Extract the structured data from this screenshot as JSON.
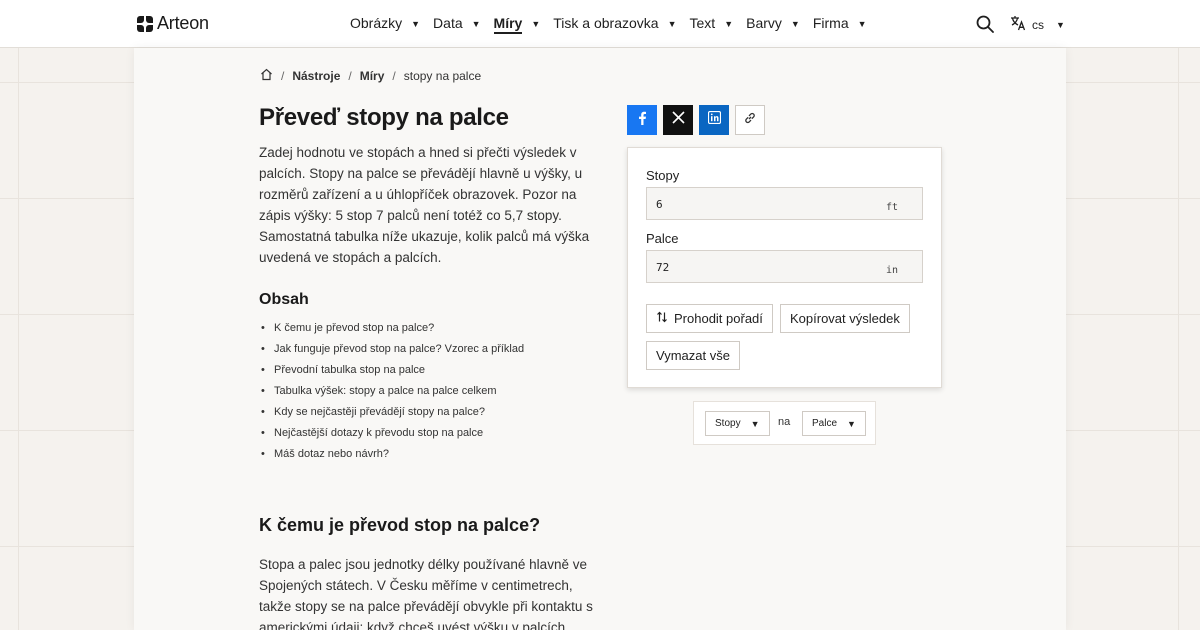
{
  "header": {
    "logo_text": "Arteon",
    "nav": [
      {
        "label": "Obrázky",
        "active": false
      },
      {
        "label": "Data",
        "active": false
      },
      {
        "label": "Míry",
        "active": true
      },
      {
        "label": "Tisk a obrazovka",
        "active": false
      },
      {
        "label": "Text",
        "active": false
      },
      {
        "label": "Barvy",
        "active": false
      },
      {
        "label": "Firma",
        "active": false
      }
    ],
    "search_icon": "search-icon",
    "lang_icon": "translate-icon",
    "lang": "cs"
  },
  "breadcrumb": {
    "home_icon": "home-icon",
    "items": [
      "Nástroje",
      "Míry",
      "stopy na palce"
    ]
  },
  "article": {
    "title": "Převeď stopy na palce",
    "intro": "Zadej hodnotu ve stopách a hned si přečti výsledek v palcích. Stopy na palce se převádějí hlavně u výšky, u rozměrů zařízení a u úhlopříček obrazovek. Pozor na zápis výšky: 5 stop 7 palců není totéž co 5,7 stopy. Samostatná tabulka níže ukazuje, kolik palců má výška uvedená ve stopách a palcích.",
    "toc_title": "Obsah",
    "toc": [
      "K čemu je převod stop na palce?",
      "Jak funguje převod stop na palce? Vzorec a příklad",
      "Převodní tabulka stop na palce",
      "Tabulka výšek: stopy a palce na palce celkem",
      "Kdy se nejčastěji převádějí stopy na palce?",
      "Nejčastější dotazy k převodu stop na palce",
      "Máš dotaz nebo návrh?"
    ],
    "section_heading": "K čemu je převod stop na palce?",
    "section_text": "Stopa a palec jsou jednotky délky používané hlavně ve Spojených státech. V Česku měříme v centimetrech, takže stopy se na palce převádějí obvykle při kontaktu s americkými údaji: když chceš uvést výšku v palcích, když ji"
  },
  "share": {
    "facebook_icon": "facebook-icon",
    "x_icon": "x-icon",
    "linkedin_icon": "linkedin-icon",
    "link_icon": "link-icon",
    "colors": {
      "facebook": "#1877f2",
      "x": "#111111",
      "linkedin": "#0a66c2"
    }
  },
  "converter": {
    "from_label": "Stopy",
    "from_value": "6",
    "from_unit": "ft",
    "to_label": "Palce",
    "to_value": "72",
    "to_unit": "in",
    "swap_label": "Prohodit pořadí",
    "copy_label": "Kopírovat výsledek",
    "clear_label": "Vymazat vše"
  },
  "unit_picker": {
    "from": "Stopy",
    "connector": "na",
    "to": "Palce"
  }
}
